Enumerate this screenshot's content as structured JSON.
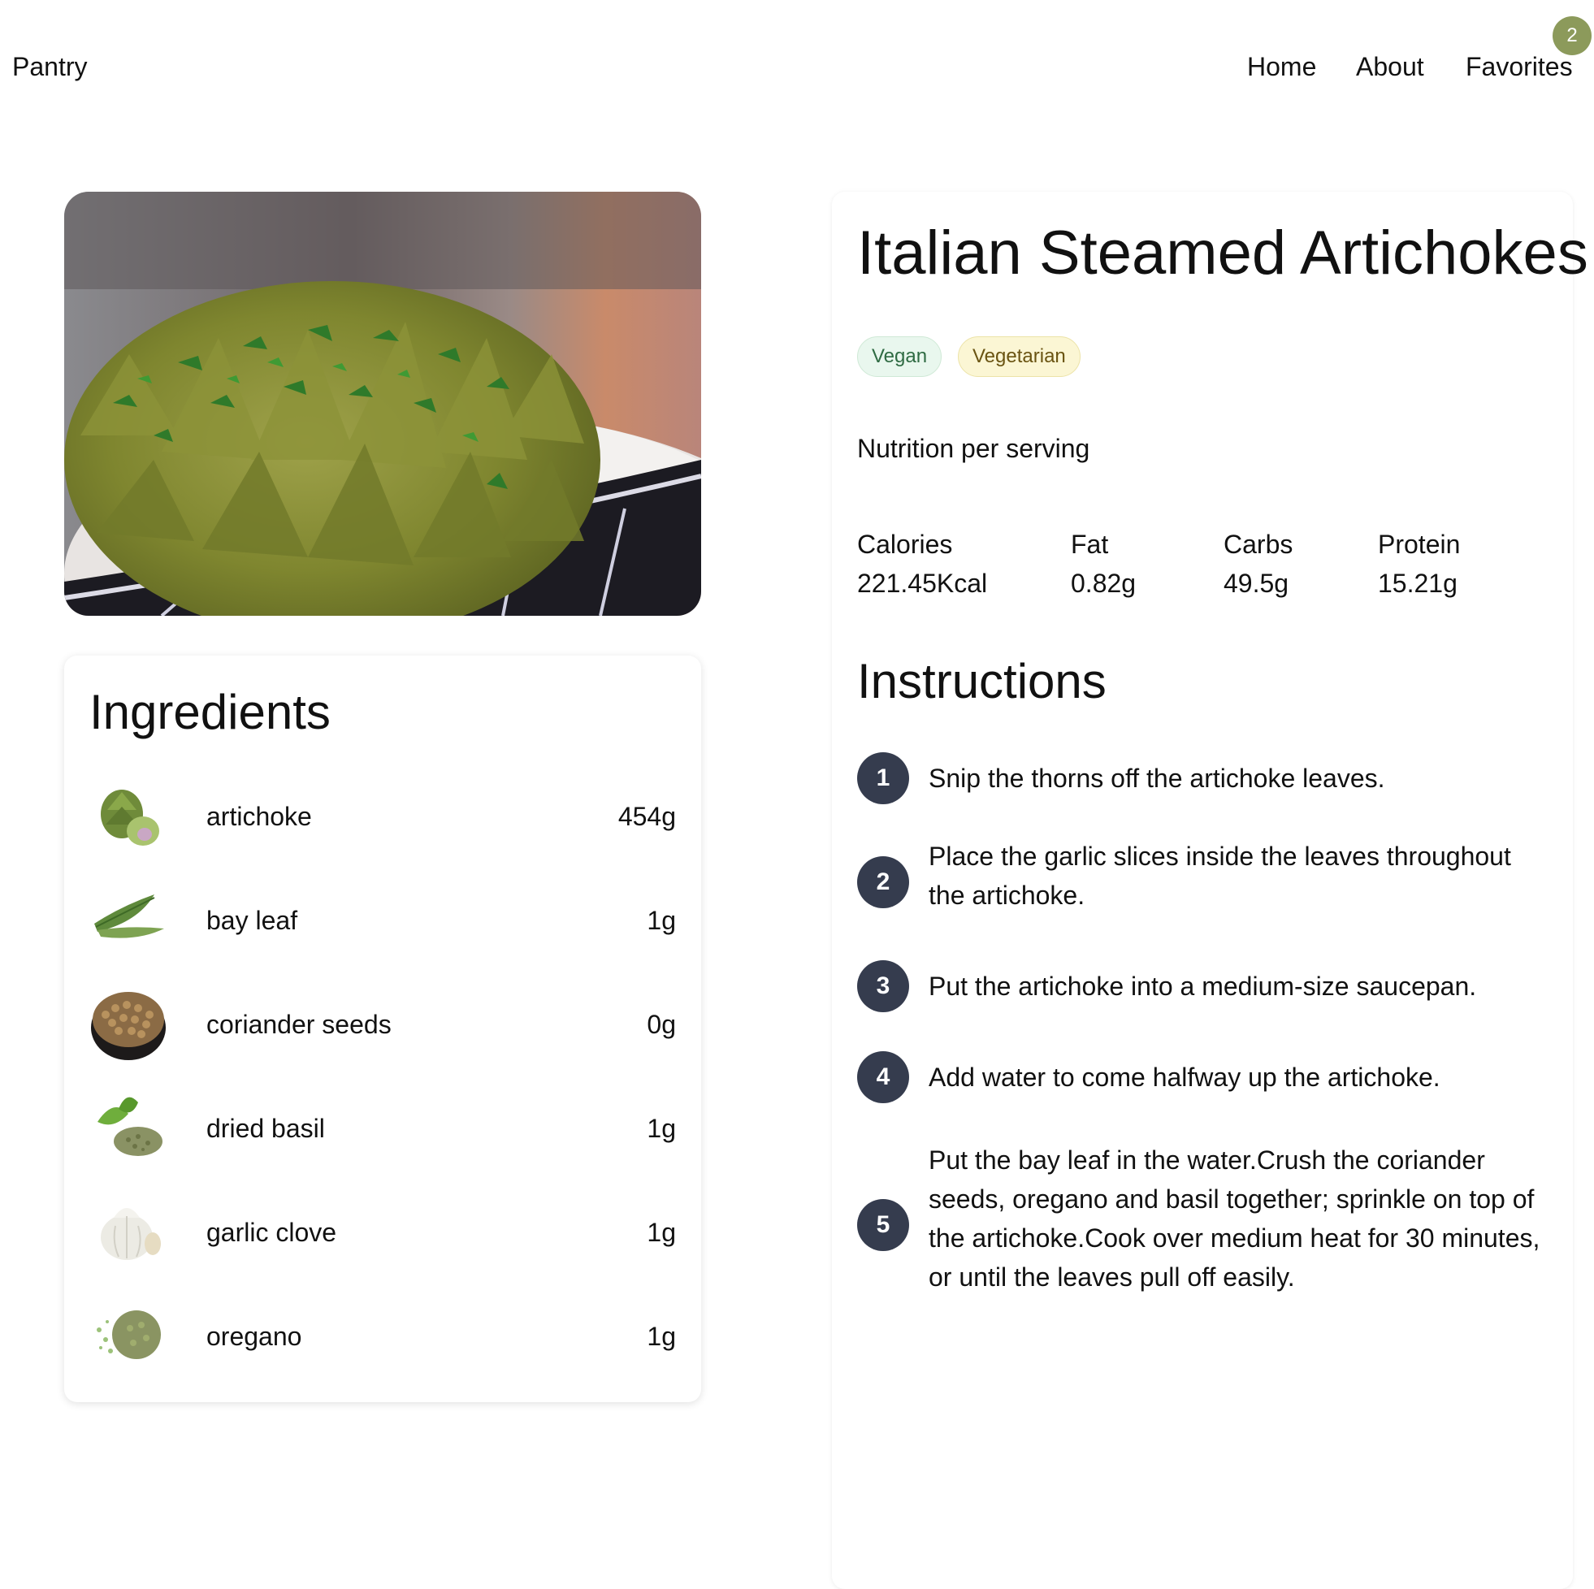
{
  "nav": {
    "brand": "Pantry",
    "links": [
      "Home",
      "About",
      "Favorites"
    ],
    "favorites_count": "2"
  },
  "recipe": {
    "title": "Italian Steamed Artichokes",
    "tags": [
      "Vegan",
      "Vegetarian"
    ],
    "nutrition_heading": "Nutrition per serving",
    "nutrition": [
      {
        "label": "Calories",
        "value": "221.45Kcal"
      },
      {
        "label": "Fat",
        "value": "0.82g"
      },
      {
        "label": "Carbs",
        "value": "49.5g"
      },
      {
        "label": "Protein",
        "value": "15.21g"
      }
    ],
    "instructions_title": "Instructions",
    "steps": [
      {
        "num": "1",
        "text": "Snip the thorns off the artichoke leaves."
      },
      {
        "num": "2",
        "text": "Place the garlic slices inside the leaves throughout the artichoke."
      },
      {
        "num": "3",
        "text": "Put the artichoke into a medium-size saucepan."
      },
      {
        "num": "4",
        "text": "Add water to come halfway up the artichoke."
      },
      {
        "num": "5",
        "text": "Put the bay leaf in the water.Crush the coriander seeds, oregano and basil together; sprinkle on top of the artichoke.Cook over medium heat for 30 minutes, or until the leaves pull off easily."
      }
    ]
  },
  "ingredients": {
    "title": "Ingredients",
    "items": [
      {
        "name": "artichoke",
        "amount": "454g",
        "icon": "artichoke-icon"
      },
      {
        "name": "bay leaf",
        "amount": "1g",
        "icon": "bay-leaf-icon"
      },
      {
        "name": "coriander seeds",
        "amount": "0g",
        "icon": "coriander-seeds-icon"
      },
      {
        "name": "dried basil",
        "amount": "1g",
        "icon": "dried-basil-icon"
      },
      {
        "name": "garlic clove",
        "amount": "1g",
        "icon": "garlic-icon"
      },
      {
        "name": "oregano",
        "amount": "1g",
        "icon": "oregano-icon"
      }
    ]
  },
  "colors": {
    "badge": "#8c9a5b",
    "step_circle": "#353c4e",
    "tag_vegan_bg": "#e9f7ee",
    "tag_vegetarian_bg": "#fbf6d4"
  }
}
